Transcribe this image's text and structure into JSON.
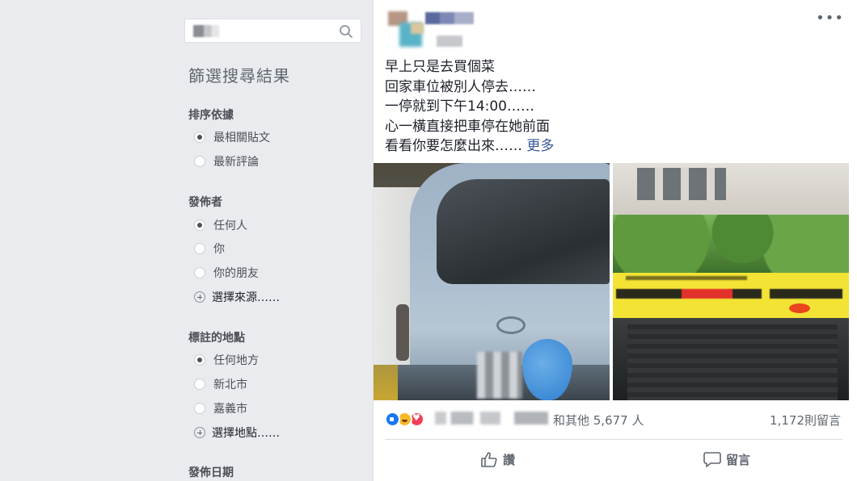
{
  "search": {
    "query": "擅"
  },
  "filters": {
    "title": "篩選搜尋結果",
    "sections": [
      {
        "heading": "排序依據",
        "options": [
          {
            "label": "最相關貼文",
            "checked": true
          },
          {
            "label": "最新評論",
            "checked": false
          }
        ]
      },
      {
        "heading": "發佈者",
        "options": [
          {
            "label": "任何人",
            "checked": true
          },
          {
            "label": "你",
            "checked": false
          },
          {
            "label": "你的朋友",
            "checked": false
          }
        ],
        "more": "選擇來源……"
      },
      {
        "heading": "標註的地點",
        "options": [
          {
            "label": "任何地方",
            "checked": true
          },
          {
            "label": "新北市",
            "checked": false
          },
          {
            "label": "嘉義市",
            "checked": false
          }
        ],
        "more": "選擇地點……"
      },
      {
        "heading": "發佈日期"
      }
    ]
  },
  "post": {
    "lines": [
      "早上只是去買個菜",
      "回家車位被別人停去……",
      "一停就到下午14:00……",
      "心一橫直接把車停在她前面",
      "看看你要怎麼出來……"
    ],
    "more_label": "更多",
    "likes_text": "和其他 5,677 人",
    "comments_count": "1,172則留言",
    "actions": {
      "like": "讚",
      "comment": "留言"
    }
  },
  "colors": {
    "accent": "#385898",
    "like": "#1877f2",
    "background": "#e9ebee"
  }
}
